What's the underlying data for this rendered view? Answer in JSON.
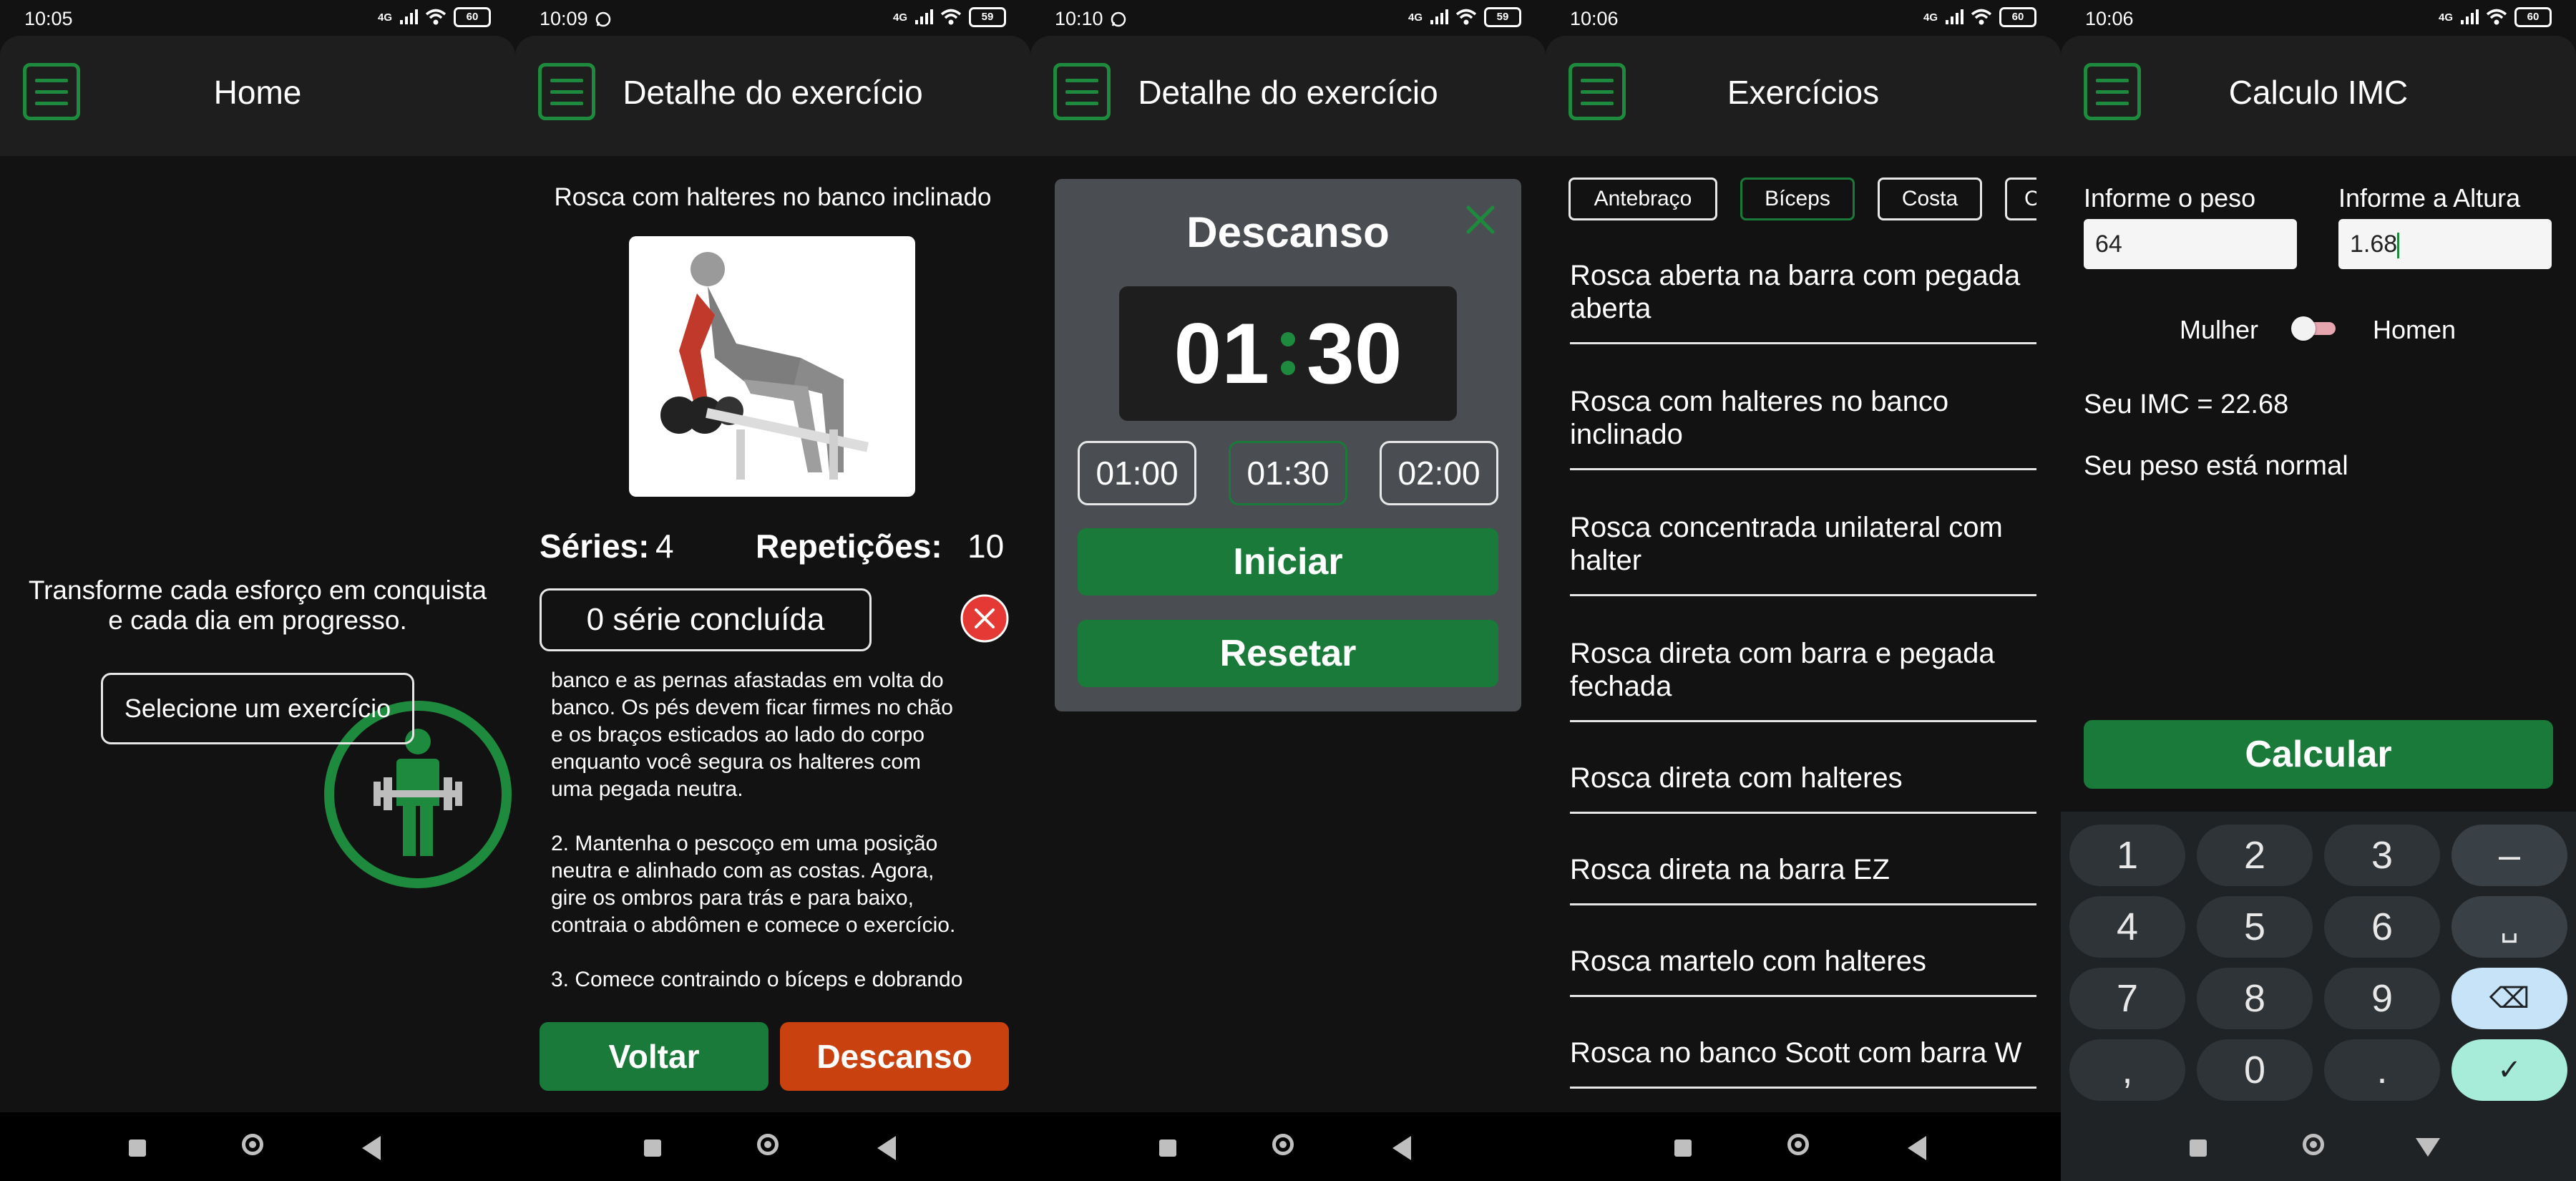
{
  "status": {
    "net": "4G",
    "screens": [
      {
        "time": "10:05",
        "whatsapp": false,
        "battery": "60"
      },
      {
        "time": "10:09",
        "whatsapp": true,
        "battery": "59"
      },
      {
        "time": "10:10",
        "whatsapp": true,
        "battery": "59"
      },
      {
        "time": "10:06",
        "whatsapp": false,
        "battery": "60"
      },
      {
        "time": "10:06",
        "whatsapp": false,
        "battery": "60"
      }
    ]
  },
  "home": {
    "title": "Home",
    "tagline_1": "Transforme cada esforço em conquista",
    "tagline_2": "e cada dia em progresso.",
    "select_button": "Selecione um exercício"
  },
  "detail": {
    "title": "Detalhe do exercício",
    "exercise_name": "Rosca com halteres no banco inclinado",
    "series_label": "Séries:",
    "series_value": "4",
    "reps_label": "Repetições:",
    "reps_value": "10",
    "completed": "0 série concluída",
    "instructions": [
      "banco e as pernas afastadas em volta do",
      "banco. Os pés devem ficar firmes no chão",
      "e os braços esticados ao lado do corpo",
      "enquanto você segura os halteres com",
      "uma pegada neutra.",
      "",
      "2. Mantenha o pescoço em uma posição",
      "neutra e alinhado com as costas. Agora,",
      "gire os ombros para trás e para baixo,",
      "contraia o abdômen e comece o exercício.",
      "",
      "3. Comece contraindo o bíceps e dobrando"
    ],
    "back_button": "Voltar",
    "rest_button": "Descanso"
  },
  "rest_dialog": {
    "title": "Detalhe do exercício",
    "heading": "Descanso",
    "minutes": "01",
    "seconds": "30",
    "presets": [
      "01:00",
      "01:30",
      "02:00"
    ],
    "selected_preset": "01:30",
    "start_button": "Iniciar",
    "reset_button": "Resetar"
  },
  "exercises": {
    "title": "Exercícios",
    "chips": [
      "Antebraço",
      "Bíceps",
      "Costa",
      "C"
    ],
    "selected_chip": "Bíceps",
    "items": [
      [
        "Rosca aberta na barra com pegada",
        "aberta"
      ],
      [
        "Rosca com halteres no banco",
        "inclinado"
      ],
      [
        "Rosca concentrada unilateral com",
        "halter"
      ],
      [
        "Rosca direta com barra e pegada",
        "fechada"
      ],
      [
        "Rosca direta com halteres"
      ],
      [
        "Rosca direta na barra EZ"
      ],
      [
        "Rosca martelo com halteres"
      ],
      [
        "Rosca no banco Scott com barra W"
      ]
    ]
  },
  "bmi": {
    "title": "Calculo IMC",
    "weight_label": "Informe o peso",
    "weight_value": "64",
    "height_label": "Informe a Altura",
    "height_value": "1.68",
    "female_label": "Mulher",
    "male_label": "Homen",
    "result": "Seu IMC = 22.68",
    "status": "Seu peso está normal",
    "calc_button": "Calcular",
    "keypad": [
      [
        "1",
        "2",
        "3",
        "–"
      ],
      [
        "4",
        "5",
        "6",
        "␣"
      ],
      [
        "7",
        "8",
        "9",
        "⌫"
      ],
      [
        ",",
        "0",
        ".",
        "✓"
      ]
    ]
  },
  "colors": {
    "accent_green": "#1a7a3a",
    "icon_green": "#1e8a3d",
    "orange": "#c8410f",
    "background": "#121212",
    "surface": "#1e1e1e",
    "dialog": "#4a4d52",
    "error_red": "#e53935"
  }
}
